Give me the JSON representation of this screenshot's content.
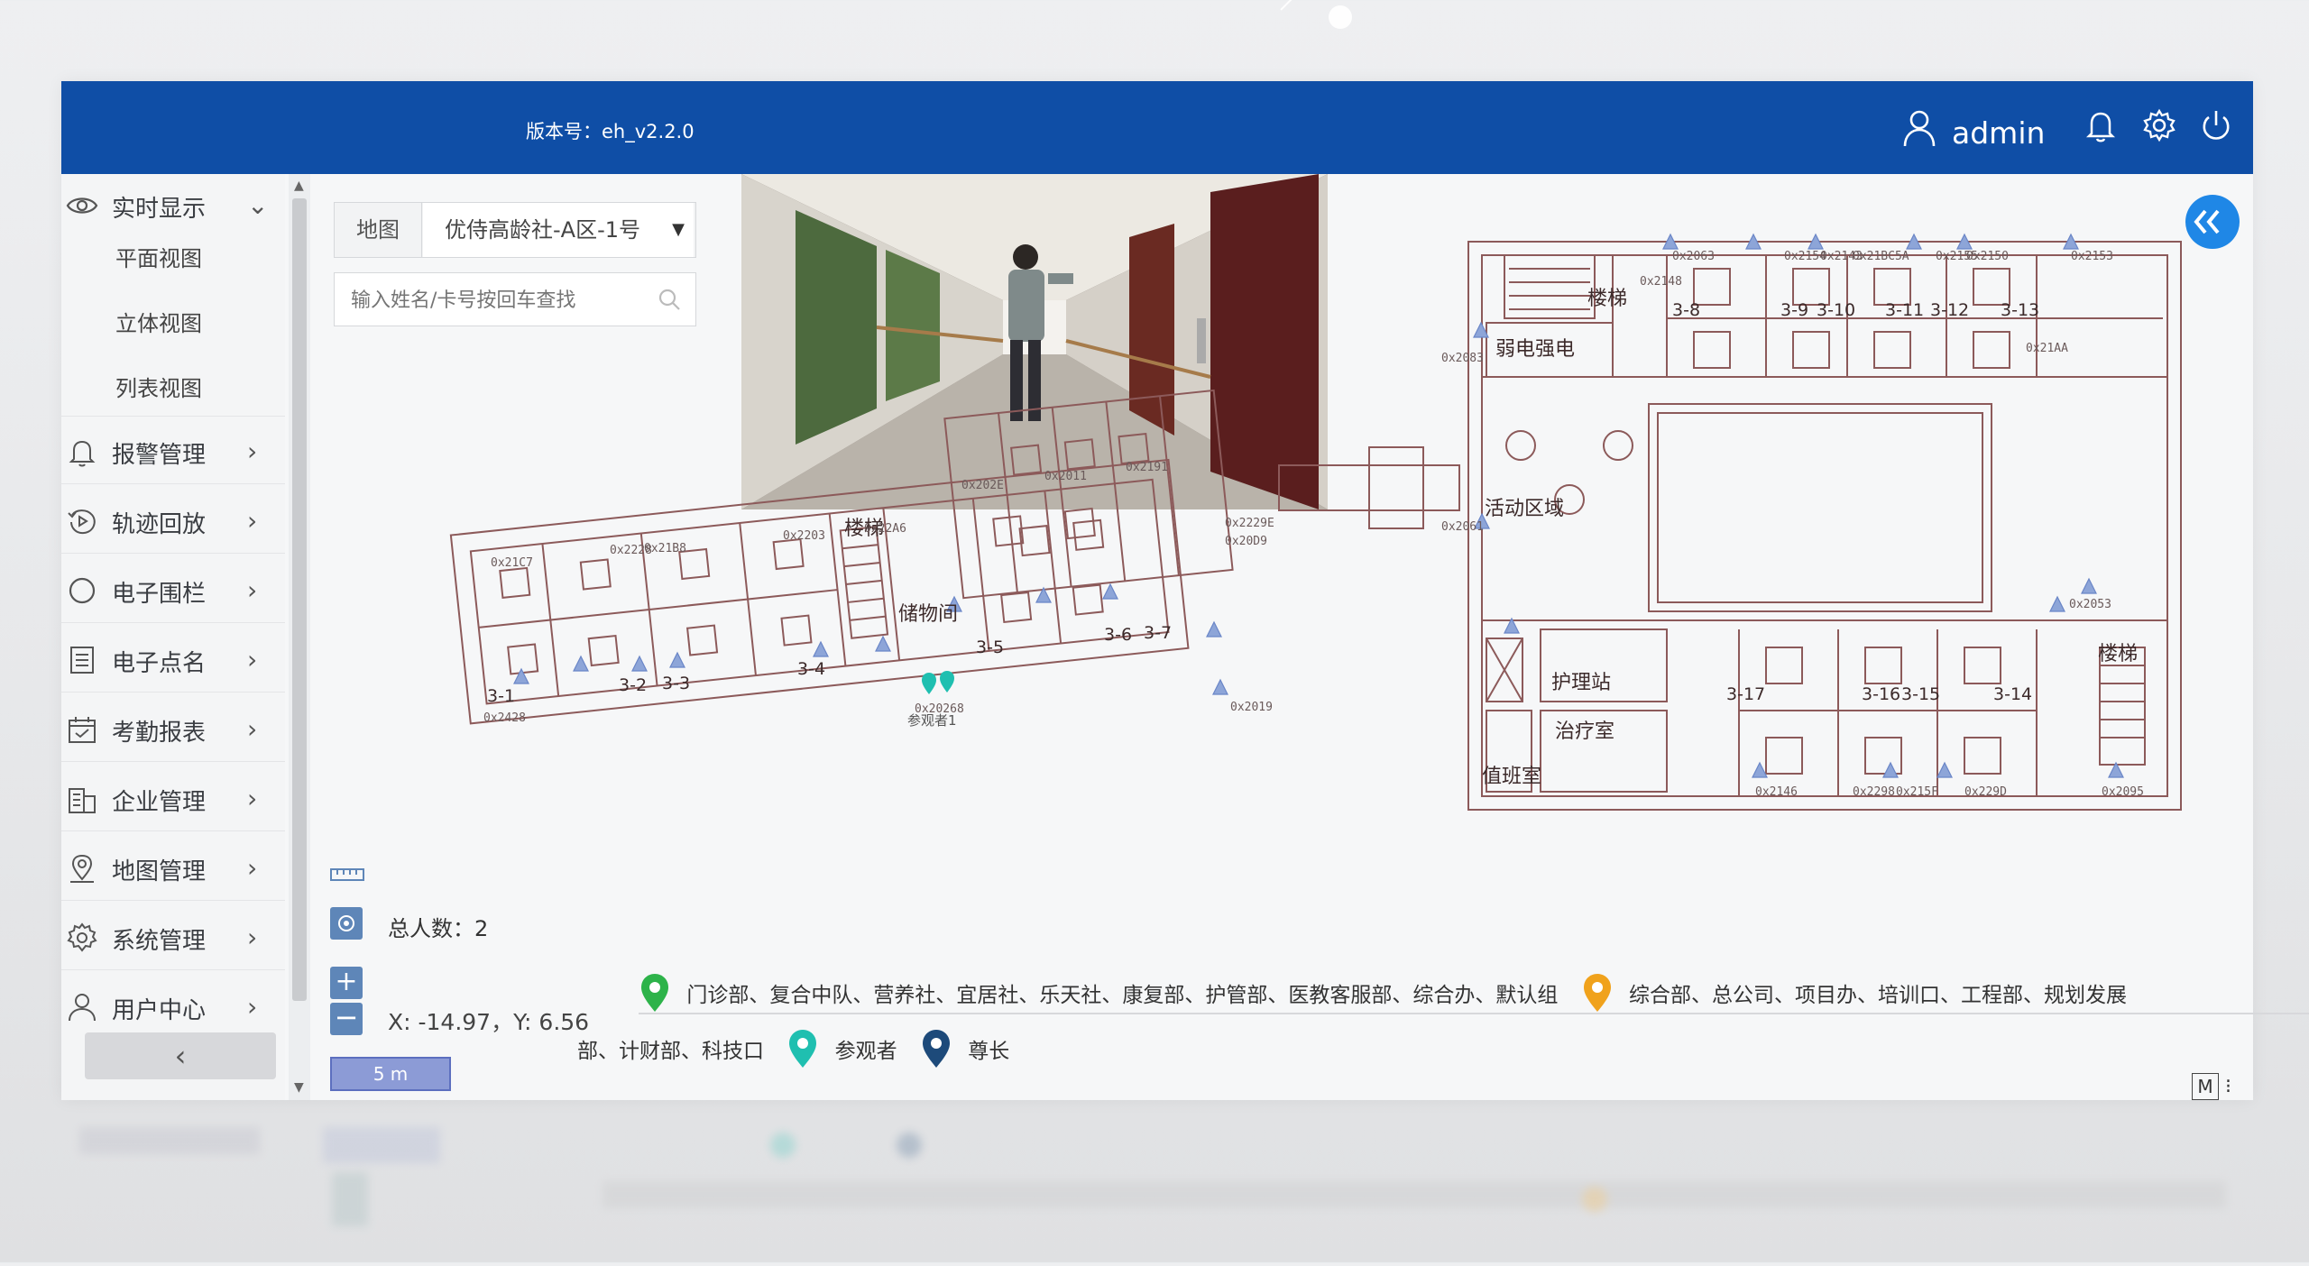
{
  "header": {
    "version": "版本号：eh_v2.2.0",
    "username": "admin",
    "icons": [
      "user-icon",
      "bell-icon",
      "gear-icon",
      "power-icon"
    ]
  },
  "sidebar": {
    "realtime": {
      "label": "实时显示",
      "icon": "eye-icon",
      "sub": [
        "平面视图",
        "立体视图",
        "列表视图"
      ]
    },
    "items": [
      {
        "label": "报警管理",
        "icon": "bell-icon"
      },
      {
        "label": "轨迹回放",
        "icon": "replay-icon"
      },
      {
        "label": "电子围栏",
        "icon": "circle-icon"
      },
      {
        "label": "电子点名",
        "icon": "list-icon"
      },
      {
        "label": "考勤报表",
        "icon": "calendar-icon"
      },
      {
        "label": "企业管理",
        "icon": "building-icon"
      },
      {
        "label": "地图管理",
        "icon": "map-pin-icon"
      },
      {
        "label": "系统管理",
        "icon": "gear-icon"
      },
      {
        "label": "用户中心",
        "icon": "user-icon"
      }
    ],
    "collapse": "‹"
  },
  "map": {
    "tab_label": "地图",
    "selected_map": "优侍高龄社-A区-1号",
    "search_placeholder": "输入姓名/卡号按回车查找",
    "total_people": "总人数：2",
    "coords": "X: -14.97，Y: 6.56",
    "scale": "5 m",
    "mode": "M",
    "rooms": {
      "stairs1": "楼梯",
      "weak_strong": "弱电强电",
      "activity": "活动区域",
      "nurse": "护理站",
      "treatment": "治疗室",
      "duty": "值班室",
      "stairs2": "楼梯",
      "storage": "储物间",
      "stairs3": "楼梯"
    },
    "room_numbers": [
      "3-1",
      "3-2",
      "3-3",
      "3-4",
      "3-5",
      "3-6",
      "3-7",
      "3-8",
      "3-9",
      "3-10",
      "3-11",
      "3-12",
      "3-13",
      "3-17",
      "3-16",
      "3-15",
      "3-14"
    ],
    "tags": [
      "0x2428",
      "0x21C7",
      "0x2228",
      "0x21B8",
      "0x2203",
      "0x22A6",
      "0x202E",
      "0x2011",
      "0x2191",
      "0x2229E",
      "0x20D9",
      "0x2063",
      "0x2148",
      "0x2154",
      "0x2143",
      "0x21BC5A",
      "0x2155",
      "0x2150",
      "0x2153",
      "0x21AA",
      "0x2083",
      "0x2061",
      "0x2053",
      "0x2146",
      "0x2298",
      "0x215F",
      "0x229D",
      "0x2095",
      "0x2019",
      "0x20268"
    ],
    "person_tag": "参观者1"
  },
  "legend": {
    "group1": "门诊部、复合中队、营养社、宜居社、乐天社、康复部、护管部、医教客服部、综合办、默认组",
    "group2_a": "综合部、总公司、项目办、培训口、工程部、规划发展",
    "group2_b": "部、计财部、科技口",
    "group3": "参观者",
    "group4": "尊长",
    "colors": {
      "green": "#2db34a",
      "orange": "#f0a21c",
      "teal": "#1fbfb0",
      "navy": "#1d4a7a"
    }
  }
}
